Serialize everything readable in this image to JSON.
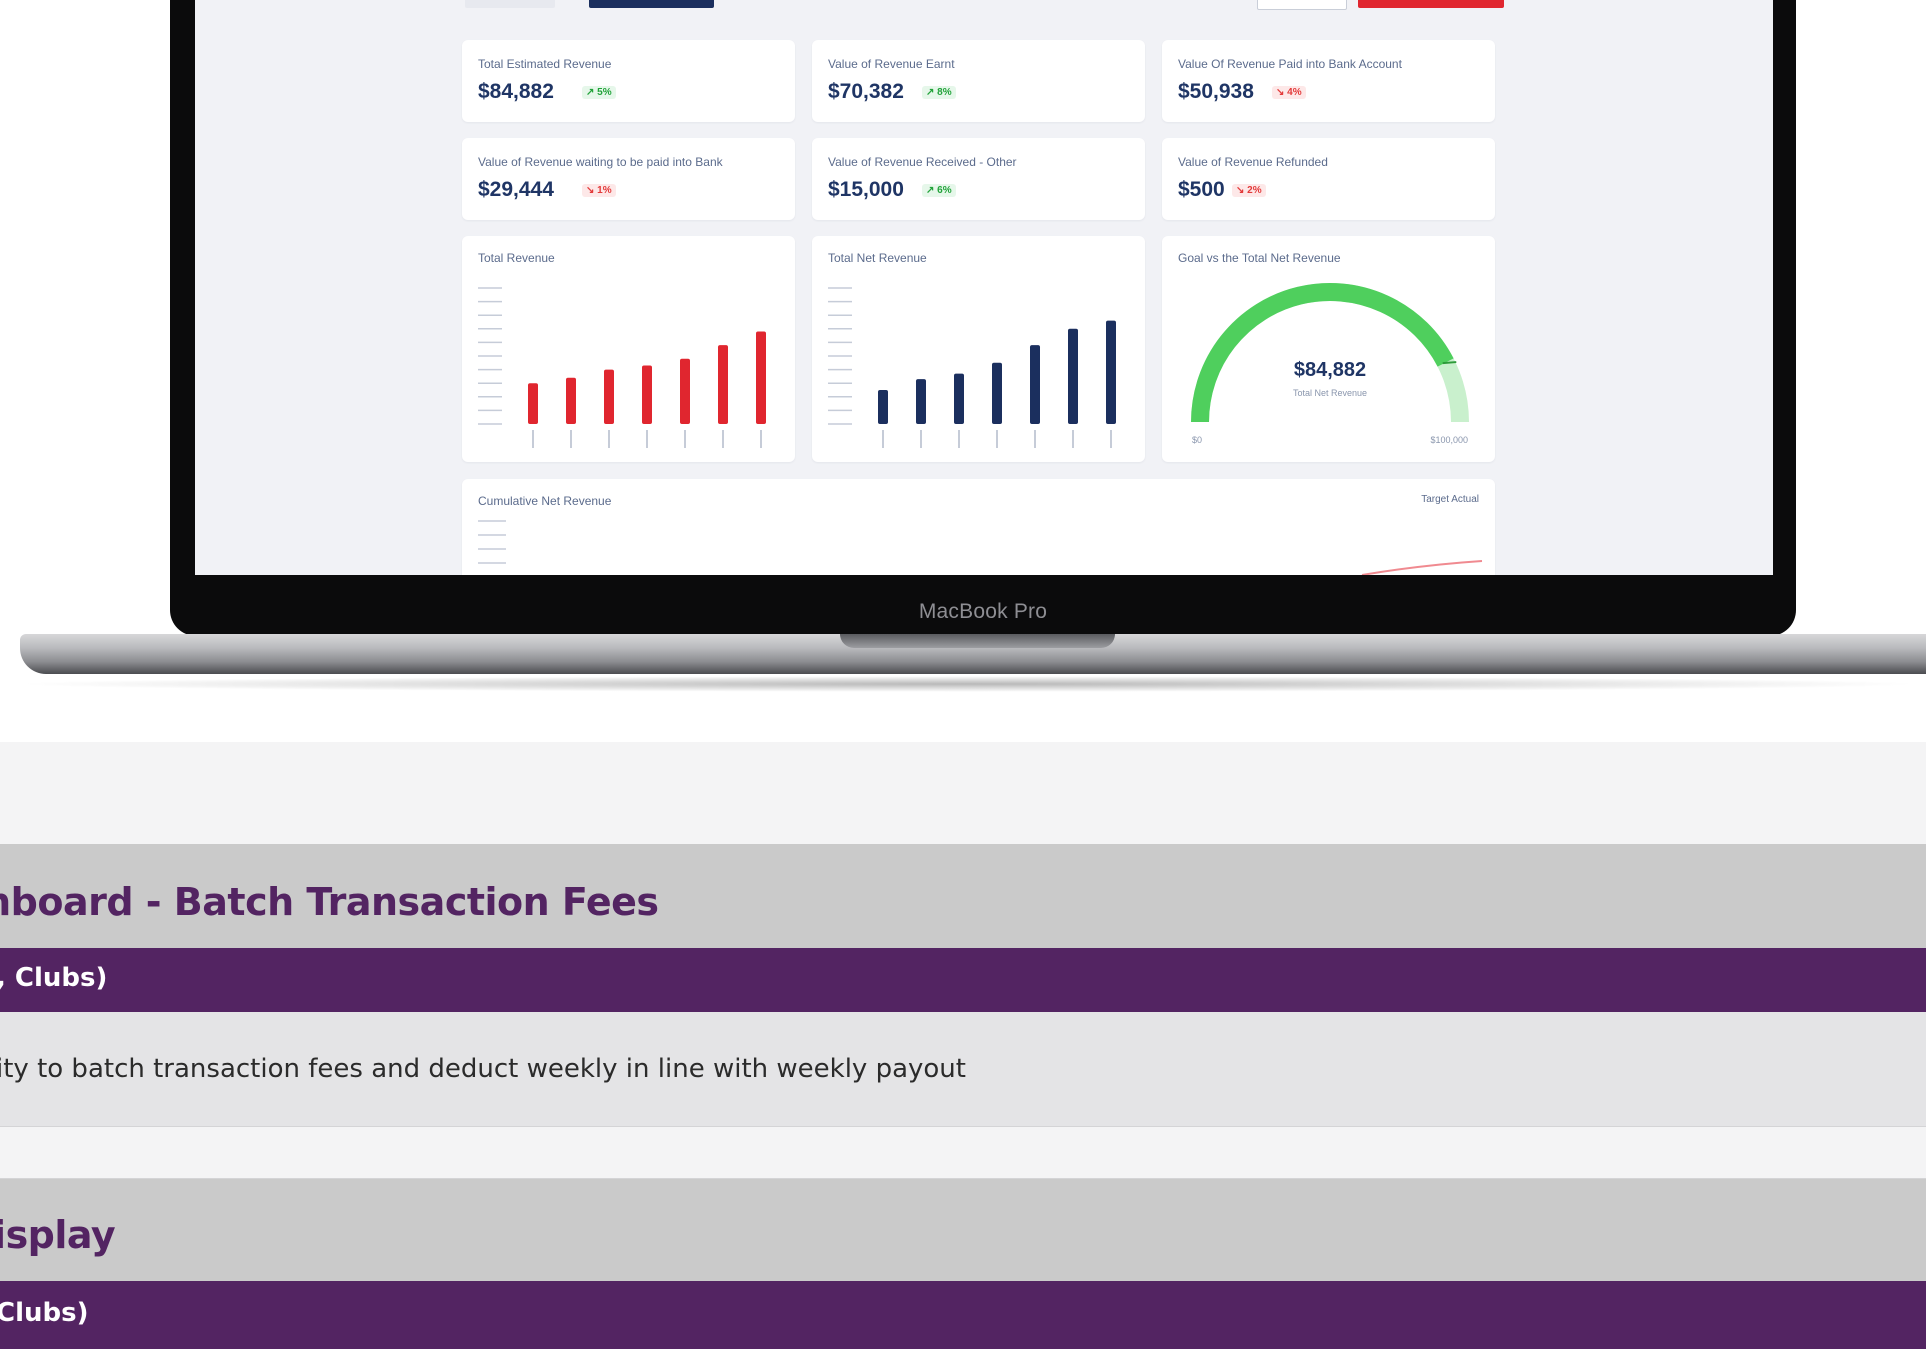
{
  "laptop": {
    "brand": "MacBook Pro"
  },
  "dashboard": {
    "kpis": [
      {
        "label": "Total Estimated Revenue",
        "value": "$84,882",
        "badge": "↗ 5%",
        "trend": "up"
      },
      {
        "label": "Value of Revenue Earnt",
        "value": "$70,382",
        "badge": "↗ 8%",
        "trend": "up"
      },
      {
        "label": "Value Of Revenue Paid into Bank Account",
        "value": "$50,938",
        "badge": "↘ 4%",
        "trend": "down"
      },
      {
        "label": "Value of Revenue waiting to be paid into Bank",
        "value": "$29,444",
        "badge": "↘ 1%",
        "trend": "down"
      },
      {
        "label": "Value of Revenue Received - Other",
        "value": "$15,000",
        "badge": "↗ 6%",
        "trend": "up"
      },
      {
        "label": "Value of Revenue Refunded",
        "value": "$500",
        "badge": "↘ 2%",
        "trend": "down"
      }
    ],
    "charts": {
      "total_revenue_title": "Total Revenue",
      "total_net_revenue_title": "Total Net Revenue",
      "gauge_title": "Goal vs the Total Net Revenue",
      "gauge_value": "$84,882",
      "gauge_caption": "Total Net Revenue",
      "gauge_min": "$0",
      "gauge_max": "$100,000",
      "cumulative_title": "Cumulative Net Revenue",
      "cumulative_legend": "Target  Actual",
      "colors": {
        "red": "#e0262f",
        "navy": "#1b2f5e",
        "green": "#4fcf5d",
        "green_light": "#c9f0cd"
      }
    }
  },
  "chart_data": [
    {
      "type": "bar",
      "title": "Total Revenue",
      "categories": [
        "",
        "",
        "",
        "",
        "",
        "",
        ""
      ],
      "values": [
        30000,
        34000,
        40000,
        43000,
        48000,
        58000,
        68000
      ],
      "ylim": [
        0,
        100000
      ]
    },
    {
      "type": "bar",
      "title": "Total Net Revenue",
      "categories": [
        "",
        "",
        "",
        "",
        "",
        "",
        ""
      ],
      "values": [
        25000,
        33000,
        37000,
        45000,
        58000,
        70000,
        76000
      ],
      "ylim": [
        0,
        100000
      ]
    },
    {
      "type": "gauge",
      "title": "Goal vs the Total Net Revenue",
      "value": 84882,
      "min": 0,
      "max": 100000
    }
  ],
  "sections": [
    {
      "title": "shboard - Batch Transaction Fees",
      "subtitle": ", Clubs)",
      "description": "ity to batch transaction fees and deduct weekly in line with weekly payout"
    },
    {
      "title": "Display",
      "subtitle": " Clubs)"
    }
  ]
}
